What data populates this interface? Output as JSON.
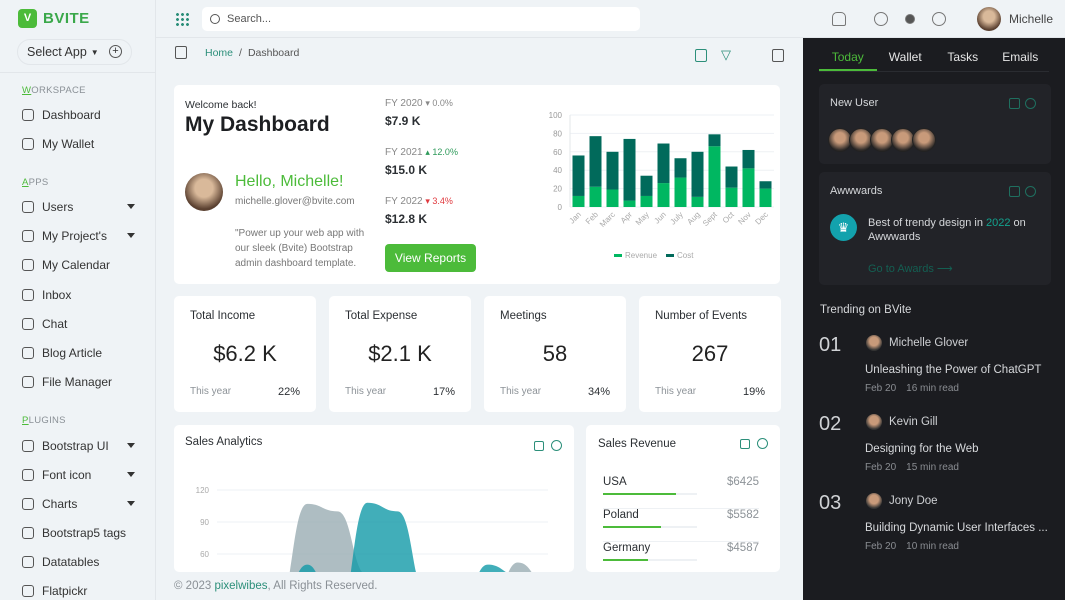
{
  "app": {
    "brand": "BVITE",
    "select_app": "Select App",
    "search_placeholder": "Search...",
    "user_name": "Michelle"
  },
  "sidebar": {
    "sections": [
      {
        "label": "WORKSPACE",
        "y": 85
      },
      {
        "label": "APPS",
        "y": 177
      },
      {
        "label": "PLUGINS",
        "y": 415
      }
    ],
    "items": [
      {
        "label": "Dashboard",
        "caret": false,
        "icon": "home-icon"
      },
      {
        "label": "My Wallet",
        "caret": false,
        "icon": "wallet-icon"
      },
      {
        "label": "Users",
        "caret": true,
        "icon": "users-icon"
      },
      {
        "label": "My Project's",
        "caret": true,
        "icon": "project-icon"
      },
      {
        "label": "My Calendar",
        "caret": false,
        "icon": "calendar-icon"
      },
      {
        "label": "Inbox",
        "caret": false,
        "icon": "inbox-icon"
      },
      {
        "label": "Chat",
        "caret": false,
        "icon": "chat-icon"
      },
      {
        "label": "Blog Article",
        "caret": false,
        "icon": "blog-icon"
      },
      {
        "label": "File Manager",
        "caret": false,
        "icon": "file-icon"
      },
      {
        "label": "Bootstrap UI",
        "caret": true,
        "icon": "bootstrap-icon"
      },
      {
        "label": "Font icon",
        "caret": true,
        "icon": "font-icon"
      },
      {
        "label": "Charts",
        "caret": true,
        "icon": "chart-icon"
      },
      {
        "label": "Bootstrap5 tags",
        "caret": false,
        "icon": "tag-icon"
      },
      {
        "label": "Datatables",
        "caret": false,
        "icon": "table-icon"
      },
      {
        "label": "Flatpickr",
        "caret": false,
        "icon": "date-icon"
      }
    ]
  },
  "breadcrumb": {
    "home": "Home",
    "sep": "/",
    "current": "Dashboard"
  },
  "welcome": {
    "greeting": "Welcome back!",
    "title": "My Dashboard",
    "hello": "Hello, Michelle!",
    "email": "michelle.glover@bvite.com",
    "quote": "\"Power up your web app with our sleek (Bvite) Bootstrap admin dashboard template.",
    "button": "View Reports"
  },
  "fy": [
    {
      "label": "FY 2020",
      "change": "▾ 0.0%",
      "value": "$7.9 K",
      "color": "#888888"
    },
    {
      "label": "FY 2021",
      "change": "▴ 12.0%",
      "value": "$15.0 K",
      "color": "#2e9a5a"
    },
    {
      "label": "FY 2022",
      "change": "▾ 3.4%",
      "value": "$12.8 K",
      "color": "#e0393e"
    }
  ],
  "chart_data": [
    {
      "type": "bar",
      "stacked": true,
      "categories": [
        "Jan",
        "Feb",
        "Marc",
        "Apr",
        "May",
        "Jun",
        "July",
        "Aug",
        "Sept",
        "Oct",
        "Nov",
        "Dec"
      ],
      "series": [
        {
          "name": "Revenue",
          "color": "#00b761",
          "values": [
            12,
            22,
            19,
            7,
            12,
            26,
            32,
            11,
            66,
            21,
            42,
            20
          ]
        },
        {
          "name": "Cost",
          "color": "#016a5b",
          "values": [
            44,
            55,
            41,
            67,
            22,
            43,
            21,
            49,
            13,
            23,
            20,
            8
          ]
        }
      ],
      "ylim": [
        0,
        100
      ],
      "yticks": [
        0,
        20,
        40,
        60,
        80,
        100
      ],
      "legend": "bottom",
      "grid": true
    },
    {
      "type": "area",
      "title": "Sales Analytics",
      "yticks": [
        60,
        90,
        120
      ],
      "series": [
        {
          "color": "#9aacb3",
          "values": [
            0,
            0,
            10,
            107,
            100,
            40,
            0,
            0,
            0,
            0,
            52,
            30
          ]
        },
        {
          "color": "#129aa8",
          "values": [
            0,
            0,
            0,
            50,
            0,
            108,
            100,
            20,
            0,
            50,
            40,
            0
          ]
        }
      ]
    }
  ],
  "stats": [
    {
      "title": "Total Income",
      "value": "$6.2 K",
      "period": "This year",
      "pct": "22%"
    },
    {
      "title": "Total Expense",
      "value": "$2.1 K",
      "period": "This year",
      "pct": "17%"
    },
    {
      "title": "Meetings",
      "value": "58",
      "period": "This year",
      "pct": "34%"
    },
    {
      "title": "Number of Events",
      "value": "267",
      "period": "This year",
      "pct": "19%"
    }
  ],
  "sales_revenue": {
    "title": "Sales Revenue",
    "rows": [
      {
        "country": "USA",
        "amount": "$6425",
        "progress": 0.78
      },
      {
        "country": "Poland",
        "amount": "$5582",
        "progress": 0.62
      },
      {
        "country": "Germany",
        "amount": "$4587",
        "progress": 0.48
      }
    ]
  },
  "footer": {
    "prefix": "© 2023 ",
    "link": "pixelwibes",
    "suffix": ", All Rights Reserved."
  },
  "right": {
    "tabs": [
      "Today",
      "Wallet",
      "Tasks",
      "Emails"
    ],
    "new_user": "New User",
    "awwwards": "Awwwards",
    "award_text_a": "Best of trendy design in ",
    "award_year": "2022",
    "award_text_b": " on Awwwards",
    "award_link": "Go to Awards ⟶",
    "trending": "Trending on BVite",
    "posts": [
      {
        "num": "01",
        "author": "Michelle Glover",
        "title": "Unleashing the Power of ChatGPT",
        "date": "Feb 20",
        "read": "16 min read"
      },
      {
        "num": "02",
        "author": "Kevin Gill",
        "title": "Designing for the Web",
        "date": "Feb 20",
        "read": "15 min read"
      },
      {
        "num": "03",
        "author": "Jony Doe",
        "title": "Building Dynamic User Interfaces ...",
        "date": "Feb 20",
        "read": "10 min read"
      }
    ]
  }
}
